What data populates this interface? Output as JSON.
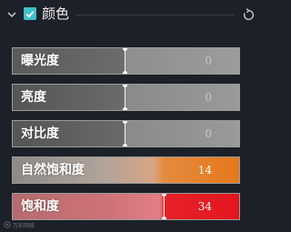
{
  "panel": {
    "title": "颜色",
    "enabled": true
  },
  "sliders": [
    {
      "label": "曝光度",
      "value": "0"
    },
    {
      "label": "亮度",
      "value": "0"
    },
    {
      "label": "对比度",
      "value": "0"
    },
    {
      "label": "自然饱和度",
      "value": "14"
    },
    {
      "label": "饱和度",
      "value": "34"
    }
  ],
  "watermark": {
    "text": "万彩网络"
  },
  "colors": {
    "checkbox_accent": "#3fc1c9",
    "vibrance_fill": "#e5781c",
    "saturation_fill": "#e3161f",
    "background": "#1c2028"
  },
  "icons": {
    "collapse": "chevron-down-icon",
    "checkbox": "check-icon",
    "reset": "reset-icon"
  }
}
